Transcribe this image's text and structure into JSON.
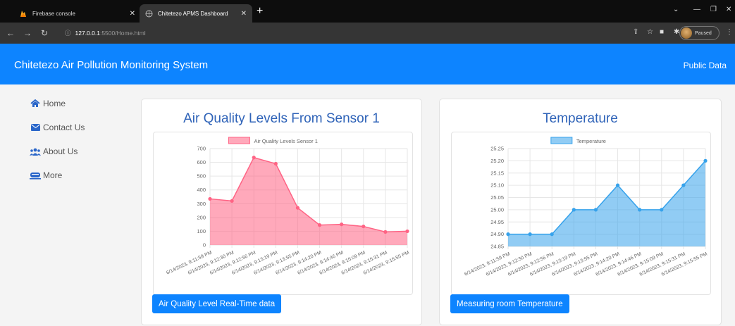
{
  "browser": {
    "tabs": [
      {
        "label": "Firebase console",
        "active": false
      },
      {
        "label": "Chitetezo APMS Dashboard",
        "active": true
      }
    ],
    "url_host": "127.0.0.1",
    "url_path": ":5500/Home.html",
    "profile_status": "Paused"
  },
  "header": {
    "title": "Chitetezo Air Pollution Monitoring System",
    "public_data": "Public Data"
  },
  "sidebar": {
    "items": [
      {
        "label": "Home",
        "icon": "home-icon"
      },
      {
        "label": "Contact Us",
        "icon": "envelope-icon"
      },
      {
        "label": "About Us",
        "icon": "users-icon"
      },
      {
        "label": "More",
        "icon": "more-icon"
      }
    ]
  },
  "cards": [
    {
      "title": "Air Quality Levels From Sensor 1",
      "button": "Air Quality Level Real-Time data"
    },
    {
      "title": "Temperature",
      "button": "Measuring room Temperature"
    }
  ],
  "chart_data": [
    {
      "type": "area",
      "legend": "Air Quality Levels Sensor 1",
      "color": "#ff6384",
      "fill": "rgba(255,99,132,0.55)",
      "x": [
        "6/14/2023, 9:11:59 PM",
        "6/14/2023, 9:12:30 PM",
        "6/14/2023, 9:12:56 PM",
        "6/14/2023, 9:13:19 PM",
        "6/14/2023, 9:13:55 PM",
        "6/14/2023, 9:14:20 PM",
        "6/14/2023, 9:14:46 PM",
        "6/14/2023, 9:15:09 PM",
        "6/14/2023, 9:15:31 PM",
        "6/14/2023, 9:15:55 PM"
      ],
      "values": [
        335,
        320,
        635,
        590,
        270,
        145,
        150,
        135,
        95,
        100
      ],
      "ylim": [
        0,
        700
      ],
      "yticks": [
        "700",
        "600",
        "500",
        "400",
        "300",
        "200",
        "100",
        "0"
      ],
      "grid": true,
      "legend_position": "top"
    },
    {
      "type": "area",
      "legend": "Temperature",
      "color": "#36a2eb",
      "fill": "rgba(54,162,235,0.55)",
      "x": [
        "6/14/2023, 9:11:59 PM",
        "6/14/2023, 9:12:30 PM",
        "6/14/2023, 9:12:56 PM",
        "6/14/2023, 9:13:19 PM",
        "6/14/2023, 9:13:55 PM",
        "6/14/2023, 9:14:20 PM",
        "6/14/2023, 9:14:46 PM",
        "6/14/2023, 9:15:09 PM",
        "6/14/2023, 9:15:31 PM",
        "6/14/2023, 9:15:55 PM"
      ],
      "values": [
        24.9,
        24.9,
        24.9,
        25.0,
        25.0,
        25.1,
        25.0,
        25.0,
        25.1,
        25.2
      ],
      "ylim": [
        24.85,
        25.25
      ],
      "yticks": [
        "25.25",
        "25.20",
        "25.15",
        "25.10",
        "25.05",
        "25.00",
        "24.95",
        "24.90",
        "24.85"
      ],
      "grid": true,
      "legend_position": "top"
    }
  ]
}
